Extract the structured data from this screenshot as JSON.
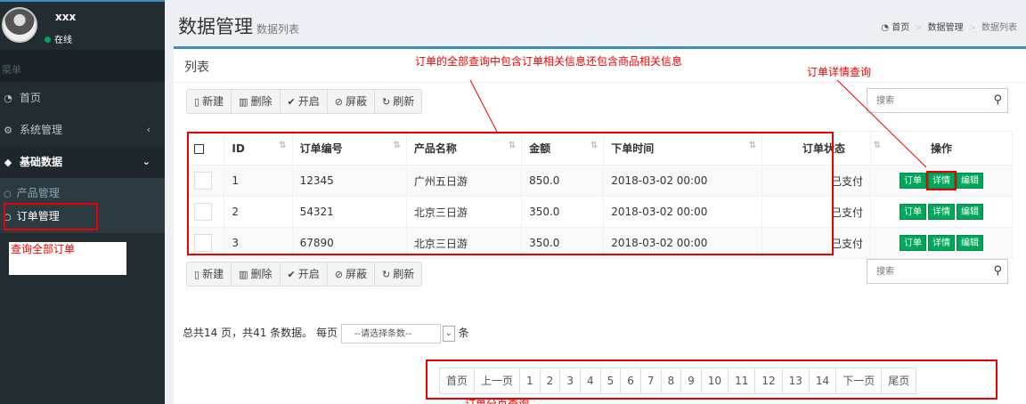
{
  "user": {
    "name": "xxx",
    "status": "在线"
  },
  "sidebar": {
    "header": "菜单",
    "items": [
      {
        "label": "首页",
        "icon": "dashboard-icon"
      },
      {
        "label": "系统管理",
        "icon": "cogs-icon"
      },
      {
        "label": "基础数据",
        "icon": "cube-icon"
      }
    ],
    "sub_items": [
      {
        "label": "产品管理"
      },
      {
        "label": "订单管理"
      }
    ]
  },
  "page": {
    "title": "数据管理",
    "subtitle": "数据列表"
  },
  "breadcrumb": {
    "home": "首页",
    "section": "数据管理",
    "current": "数据列表"
  },
  "box": {
    "title": "列表"
  },
  "toolbar": {
    "new": "新建",
    "delete": "删除",
    "enable": "开启",
    "block": "屏蔽",
    "refresh": "刷新"
  },
  "search": {
    "placeholder": "搜索"
  },
  "table": {
    "headers": {
      "id": "ID",
      "order_no": "订单编号",
      "product": "产品名称",
      "amount": "金额",
      "time": "下单时间",
      "status": "订单状态",
      "actions": "操作"
    },
    "rows": [
      {
        "id": "1",
        "order_no": "12345",
        "product": "广州五日游",
        "amount": "850.0",
        "time": "2018-03-02 00:00",
        "status": "已支付"
      },
      {
        "id": "2",
        "order_no": "54321",
        "product": "北京三日游",
        "amount": "350.0",
        "time": "2018-03-02 00:00",
        "status": "已支付"
      },
      {
        "id": "3",
        "order_no": "67890",
        "product": "北京三日游",
        "amount": "350.0",
        "time": "2018-03-02 00:00",
        "status": "已支付"
      }
    ],
    "action_labels": {
      "order": "订单",
      "detail": "详情",
      "edit": "编辑"
    }
  },
  "pager": {
    "info": "总共14 页，共41 条数据。 每页",
    "page_size_placeholder": "--请选择条数--",
    "unit": "条",
    "first": "首页",
    "prev": "上一页",
    "next": "下一页",
    "last": "尾页",
    "pages": [
      "1",
      "2",
      "3",
      "4",
      "5",
      "6",
      "7",
      "8",
      "9",
      "10",
      "11",
      "12",
      "13",
      "14"
    ]
  },
  "annotations": {
    "query_all": "查询全部订单",
    "full_query": "订单的全部查询中包含订单相关信息还包含商品相关信息",
    "detail_query": "订单详情查询",
    "paging_query": "订单分页查询"
  }
}
